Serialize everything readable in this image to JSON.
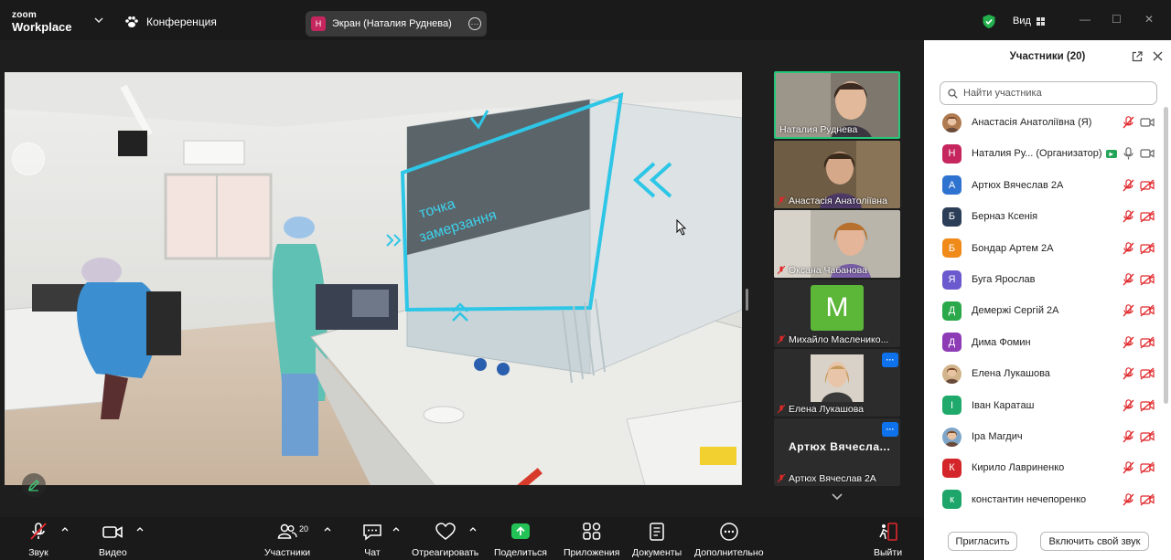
{
  "titlebar": {
    "logo_line1": "zoom",
    "logo_line2": "Workplace",
    "meeting_label": "Конференция",
    "share_pill": {
      "initial": "Н",
      "label": "Экран (Наталия Руднева)"
    },
    "view_label": "Вид"
  },
  "shared_screen": {
    "overlay_text_line1": "точка",
    "overlay_text_line2": "замерзання"
  },
  "gallery": [
    {
      "name": "Наталия Руднева",
      "muted": false,
      "active": true,
      "tone": "#8a8478"
    },
    {
      "name": "Анастасія Анатоліївна",
      "muted": true,
      "tone": "#8c7a5e"
    },
    {
      "name": "Оксана Чабанова",
      "muted": true,
      "tone": "#a8a49a"
    },
    {
      "name": "Михайло Масленико...",
      "muted": true,
      "initial": "M",
      "avatar_color": "#5cb638"
    },
    {
      "name": "Елена Лукашова",
      "muted": true,
      "tone": "#2a2a2a"
    },
    {
      "name": "Артюх Вячеслав 2А",
      "muted": true,
      "big_name": "Артюх Вячесла..."
    }
  ],
  "panel": {
    "title": "Участники (20)",
    "search_placeholder": "Найти участника",
    "participants": [
      {
        "initial": "",
        "photo": true,
        "name": "Анастасія Анатоліївна (Я)",
        "color": "#b07a50",
        "cam": "on",
        "mic": "muted"
      },
      {
        "initial": "Н",
        "name": "Наталия Ру... (Организатор)",
        "color": "#c5265e",
        "host": true,
        "cam": "on",
        "mic": "on"
      },
      {
        "initial": "А",
        "name": "Артюх Вячеслав 2А",
        "color": "#2f73d1",
        "cam": "off",
        "mic": "muted"
      },
      {
        "initial": "Б",
        "name": "Берназ Ксенія",
        "color": "#2c3e57",
        "cam": "off",
        "mic": "muted"
      },
      {
        "initial": "Б",
        "name": "Бондар Артем 2А",
        "color": "#f08a18",
        "cam": "off",
        "mic": "muted"
      },
      {
        "initial": "Я",
        "name": "Буга Ярослав",
        "color": "#6a5acd",
        "cam": "off",
        "mic": "muted"
      },
      {
        "initial": "Д",
        "name": "Демержі Сергій 2А",
        "color": "#2ba84a",
        "cam": "off",
        "mic": "muted"
      },
      {
        "initial": "Д",
        "name": "Дима Фомин",
        "color": "#8e3bb6",
        "cam": "off",
        "mic": "muted"
      },
      {
        "initial": "",
        "photo": true,
        "name": "Елена Лукашова",
        "color": "#d2b48c",
        "cam": "off",
        "mic": "muted"
      },
      {
        "initial": "І",
        "name": "Іван Караташ",
        "color": "#1faa6b",
        "cam": "off",
        "mic": "muted"
      },
      {
        "initial": "",
        "photo": true,
        "name": "Іра Магдич",
        "color": "#7fa6c9",
        "cam": "off",
        "mic": "muted"
      },
      {
        "initial": "К",
        "name": "Кирило Лавриненко",
        "color": "#d4262a",
        "cam": "off",
        "mic": "muted"
      },
      {
        "initial": "к",
        "name": "константин нечепоренко",
        "color": "#1ea56a",
        "cam": "off",
        "mic": "muted"
      }
    ],
    "invite_label": "Пригласить",
    "unmute_label": "Включить свой звук"
  },
  "toolbar": {
    "audio": "Звук",
    "video": "Видео",
    "participants": "Участники",
    "participants_count": "20",
    "chat": "Чат",
    "react": "Отреагировать",
    "share": "Поделиться",
    "apps": "Приложения",
    "docs": "Документы",
    "more": "Дополнительно",
    "leave": "Выйти"
  }
}
